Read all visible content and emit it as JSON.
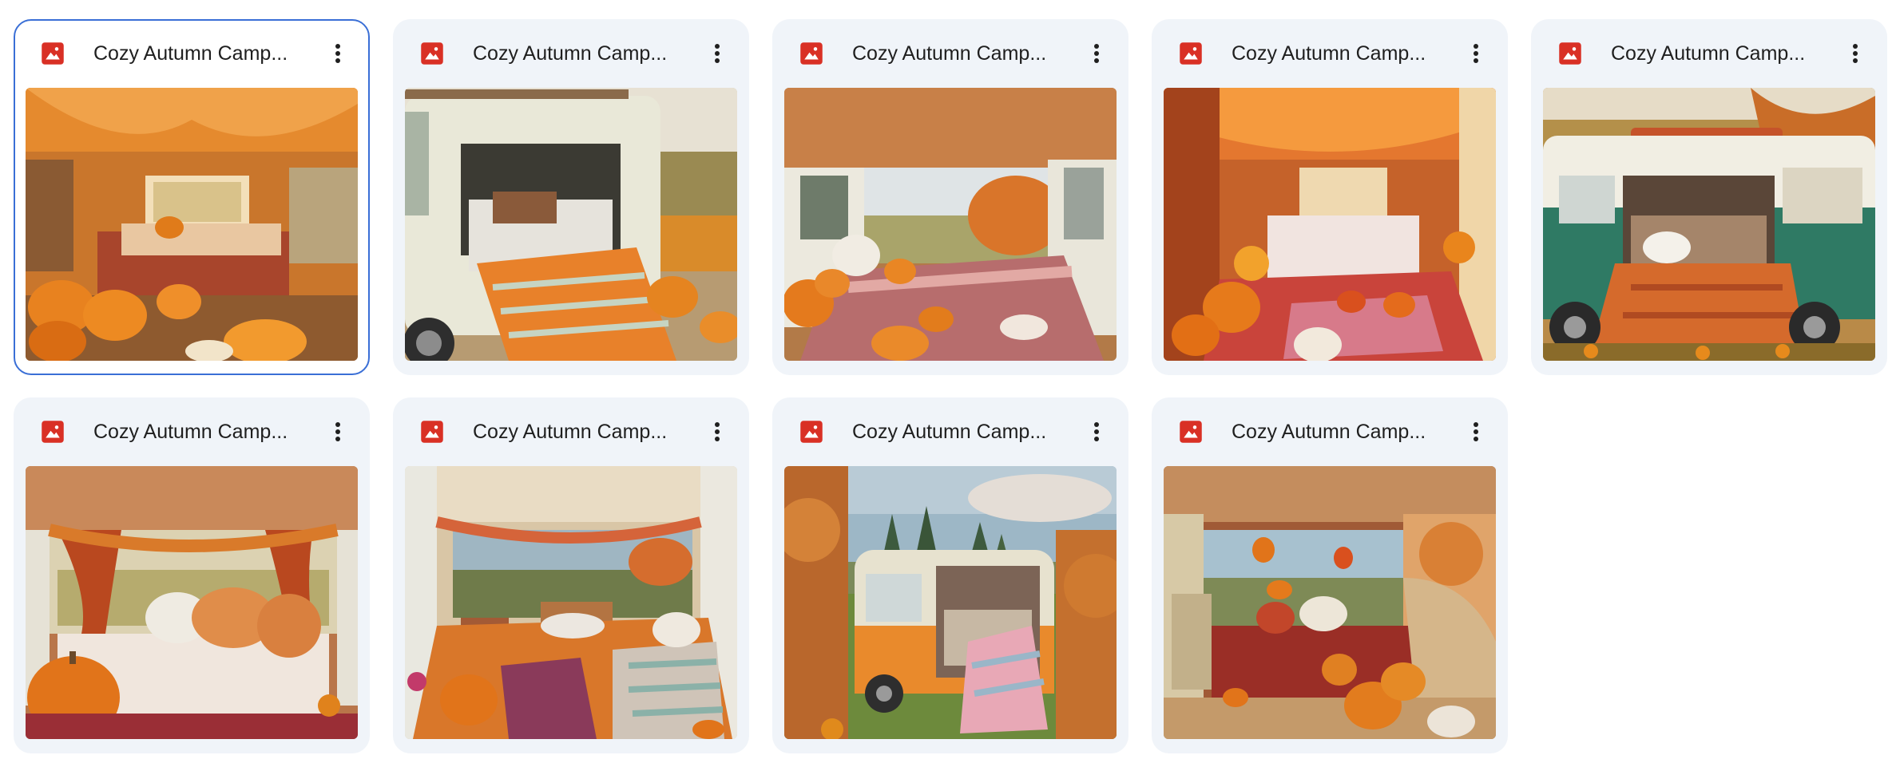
{
  "colors": {
    "card_bg": "#f0f4f9",
    "selected_border": "#3a6fd6",
    "image_icon_red": "#d93025",
    "text": "#1f1f1f"
  },
  "files": [
    {
      "name": "Cozy Autumn Camp...",
      "type_icon": "image-file-icon",
      "menu_icon": "more-vert-icon",
      "selected": true,
      "thumbnail": "van interior with orange canopy, pumpkins and bed"
    },
    {
      "name": "Cozy Autumn Camp...",
      "type_icon": "image-file-icon",
      "menu_icon": "more-vert-icon",
      "selected": false,
      "thumbnail": "cream van with open side door in field"
    },
    {
      "name": "Cozy Autumn Camp...",
      "type_icon": "image-file-icon",
      "menu_icon": "more-vert-icon",
      "selected": false,
      "thumbnail": "van interior rear view with pink bedding and pumpkins"
    },
    {
      "name": "Cozy Autumn Camp...",
      "type_icon": "image-file-icon",
      "menu_icon": "more-vert-icon",
      "selected": false,
      "thumbnail": "van interior with orange curtains and flowers"
    },
    {
      "name": "Cozy Autumn Camp...",
      "type_icon": "image-file-icon",
      "menu_icon": "more-vert-icon",
      "selected": false,
      "thumbnail": "green and white van with orange blanket"
    },
    {
      "name": "Cozy Autumn Camp...",
      "type_icon": "image-file-icon",
      "menu_icon": "more-vert-icon",
      "selected": false,
      "thumbnail": "van interior with orange pillows and large pumpkin"
    },
    {
      "name": "Cozy Autumn Camp...",
      "type_icon": "image-file-icon",
      "menu_icon": "more-vert-icon",
      "selected": false,
      "thumbnail": "van interior with plaid blankets and garland"
    },
    {
      "name": "Cozy Autumn Camp...",
      "type_icon": "image-file-icon",
      "menu_icon": "more-vert-icon",
      "selected": false,
      "thumbnail": "orange van parked in forest meadow"
    },
    {
      "name": "Cozy Autumn Camp...",
      "type_icon": "image-file-icon",
      "menu_icon": "more-vert-icon",
      "selected": false,
      "thumbnail": "van interior with hanging pumpkins and red bedding"
    }
  ]
}
